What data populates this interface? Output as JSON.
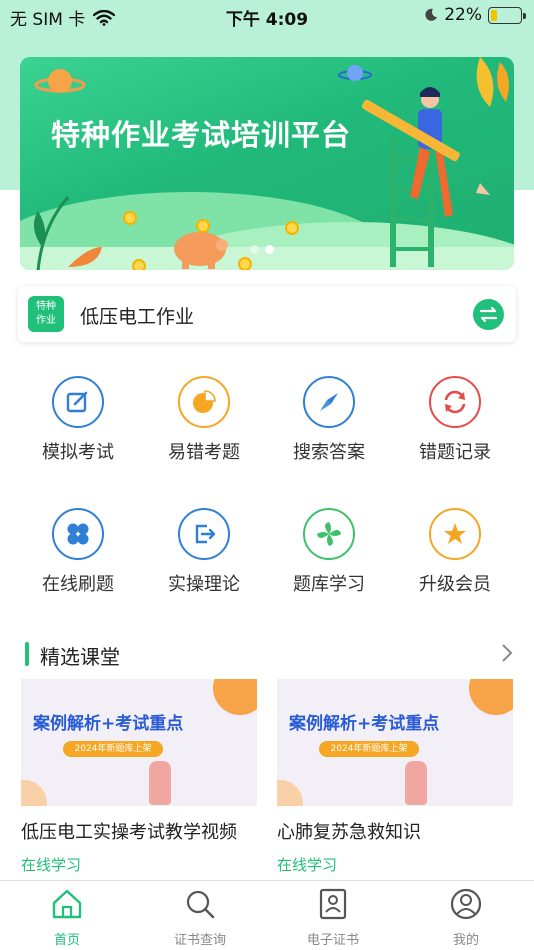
{
  "status_bar": {
    "carrier": "无 SIM 卡",
    "time": "下午 4:09",
    "battery": "22%",
    "battery_level": 0.22
  },
  "banner": {
    "title": "特种作业考试培训平台"
  },
  "selector": {
    "badge_line1": "特种",
    "badge_line2": "作业",
    "value": "低压电工作业"
  },
  "grid": [
    {
      "label": "模拟考试",
      "icon": "edit-icon",
      "color": "#2f7fd6"
    },
    {
      "label": "易错考题",
      "icon": "pie-chart-icon",
      "color": "#f5a623"
    },
    {
      "label": "搜索答案",
      "icon": "compass-icon",
      "color": "#2f7fd6"
    },
    {
      "label": "错题记录",
      "icon": "refresh-icon",
      "color": "#e84a4a"
    },
    {
      "label": "在线刷题",
      "icon": "clover-icon",
      "color": "#2f7fd6"
    },
    {
      "label": "实操理论",
      "icon": "export-icon",
      "color": "#2f7fd6"
    },
    {
      "label": "题库学习",
      "icon": "pinwheel-icon",
      "color": "#3dc16a"
    },
    {
      "label": "升级会员",
      "icon": "star-icon",
      "color": "#f5a623"
    }
  ],
  "section": {
    "title": "精选课堂"
  },
  "courses": [
    {
      "thumb_title": "案例解析+考试重点",
      "thumb_pill": "2024年新题库上架",
      "title": "低压电工实操考试教学视频",
      "tag": "在线学习"
    },
    {
      "thumb_title": "案例解析+考试重点",
      "thumb_pill": "2024年新题库上架",
      "title": "心肺复苏急救知识",
      "tag": "在线学习"
    }
  ],
  "tabs": [
    {
      "label": "首页",
      "icon": "home-icon",
      "active": true
    },
    {
      "label": "证书查询",
      "icon": "search-icon",
      "active": false
    },
    {
      "label": "电子证书",
      "icon": "certificate-icon",
      "active": false
    },
    {
      "label": "我的",
      "icon": "user-icon",
      "active": false
    }
  ],
  "colors": {
    "accent": "#20c07a",
    "header_bg": "#b8f0d8"
  }
}
